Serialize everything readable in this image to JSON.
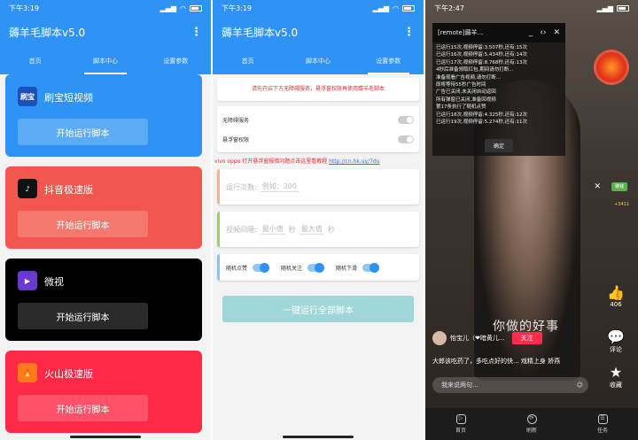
{
  "screen1": {
    "status_time": "下午3:19",
    "app_title": "薅羊毛脚本v5.0",
    "tabs": [
      "首页",
      "脚本中心",
      "设置参数"
    ],
    "active_tab": 1,
    "cards": [
      {
        "icon_text": "刷宝",
        "icon_color": "#1f4fb8",
        "title": "刷宝短视频",
        "button": "开始运行脚本",
        "bg": "#2f93f5",
        "btn_bg": "#5cabf7"
      },
      {
        "icon_text": "♪",
        "icon_color": "#111111",
        "title": "抖音极速版",
        "button": "开始运行脚本",
        "bg": "#f2564e",
        "btn_bg": "#f5786f"
      },
      {
        "icon_text": "▶",
        "icon_color": "#6a3ad0",
        "title": "微视",
        "button": "开始运行脚本",
        "bg": "#000000",
        "btn_bg": "#2a2a2a"
      },
      {
        "icon_text": "🔥",
        "icon_color": "#ff7a1a",
        "title": "火山极速版",
        "button": "开始运行脚本",
        "bg": "#ff2a48",
        "btn_bg": "#ff5268"
      }
    ]
  },
  "screen2": {
    "status_time": "下午3:19",
    "app_title": "薅羊毛脚本v5.0",
    "tabs": [
      "首页",
      "脚本中心",
      "设置参数"
    ],
    "active_tab": 2,
    "notice": "请先开启下方无障碍服务，悬浮窗权限再使用薅羊毛脚本",
    "accessibility_label": "无障碍服务",
    "float_label": "悬浮窗权限",
    "vivo_notice": "vivo oppo 打开悬浮窗报错问题点击这里看教程",
    "vivo_link": "http://cn.hk.uy/7du",
    "run_count_label": "运行次数:",
    "run_count_placeholder": "例如：200",
    "interval_label": "视频间隔:",
    "min_placeholder": "最小值",
    "sec1": "秒",
    "max_placeholder": "最大值",
    "sec2": "秒",
    "random_like": "随机点赞",
    "random_follow": "随机关注",
    "random_swipe": "随机下滑",
    "run_all": "一键运行全部脚本"
  },
  "screen3": {
    "status_time": "下午2:47",
    "log_title": "[remote]薅羊...",
    "log_lines": [
      "已运行15次,视频停留:3.507秒,还有:15次",
      "已运行16次,视频停留:5.434秒,还有:14次",
      "已运行17次,视频停留:8.768秒,还有:13次",
      "4秒后准备领取红包,期间请勿打断...",
      "准备观看广告视频,请勿打断...",
      "即将等待55秒广告时间",
      "广告已关闭,未关闭自动返回",
      "所有弹窗已关闭,准备回视频",
      "第17条执行了随机点赞",
      "已运行18次,视频停留:4.325秒,还有:12次",
      "已运行19次,视频停留:5.274秒,还有:11次"
    ],
    "log_ok": "确定",
    "coin_text": "+3411",
    "mini_label": "赚钱",
    "likes": "406",
    "comment_label": "评论",
    "fav_label": "收藏",
    "overlay_text": "你做的好事",
    "username": "怡宝儿（❤暗黄儿...",
    "follow": "关注",
    "caption": "大郎该吃药了，多吃点好的快... 戏精上身 娇燕",
    "comment_placeholder": "我来说两句...",
    "nav": [
      "首页",
      "刷新",
      "任务"
    ]
  }
}
